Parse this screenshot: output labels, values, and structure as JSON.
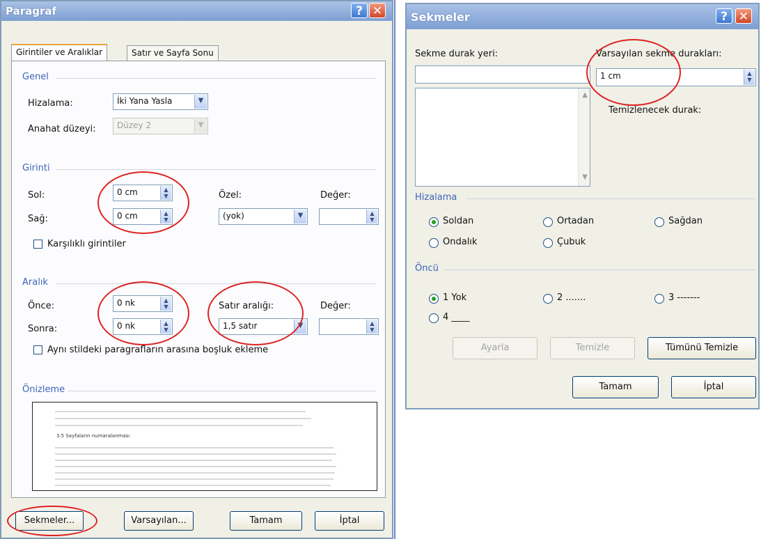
{
  "paragraph_dialog": {
    "title": "Paragraf",
    "help_glyph": "?",
    "close_glyph": "✕",
    "tabs": [
      "Girintiler ve Aralıklar",
      "Satır ve Sayfa Sonu"
    ],
    "general": {
      "section": "Genel",
      "alignment_label": "Hizalama:",
      "alignment_value": "İki Yana Yasla",
      "outline_label": "Anahat düzeyi:",
      "outline_value": "Düzey 2"
    },
    "indent": {
      "section": "Girinti",
      "left_label": "Sol:",
      "left_value": "0 cm",
      "right_label": "Sağ:",
      "right_value": "0 cm",
      "special_label": "Özel:",
      "special_value": "(yok)",
      "value_label": "Değer:",
      "mirror_label": "Karşılıklı girintiler"
    },
    "spacing": {
      "section": "Aralık",
      "before_label": "Önce:",
      "before_value": "0 nk",
      "after_label": "Sonra:",
      "after_value": "0 nk",
      "line_label": "Satır aralığı:",
      "line_value": "1,5 satır",
      "value_label": "Değer:",
      "no_space_label": "Aynı stildeki paragrafların arasına boşluk ekleme"
    },
    "preview": {
      "section": "Önizleme",
      "sample_heading": "3.5 Sayfaların numaralanması"
    },
    "buttons": {
      "tabs": "Sekmeler...",
      "defaults": "Varsayılan...",
      "ok": "Tamam",
      "cancel": "İptal"
    }
  },
  "tabs_dialog": {
    "title": "Sekmeler",
    "help_glyph": "?",
    "close_glyph": "✕",
    "tab_stop_label": "Sekme durak yeri:",
    "tab_stop_value": "",
    "default_stops_label": "Varsayılan sekme durakları:",
    "default_stops_value": "1 cm",
    "to_clear_label": "Temizlenecek durak:",
    "alignment": {
      "section": "Hizalama",
      "options": [
        "Soldan",
        "Ortadan",
        "Sağdan",
        "Ondalık",
        "Çubuk"
      ],
      "selected": "Soldan"
    },
    "leader": {
      "section": "Öncü",
      "options": [
        "1 Yok",
        "2 .......",
        "3 -------",
        "4 ____"
      ],
      "selected": "1 Yok"
    },
    "buttons": {
      "set": "Ayarla",
      "clear": "Temizle",
      "clear_all": "Tümünü Temizle",
      "ok": "Tamam",
      "cancel": "İptal"
    }
  },
  "colors": {
    "accent_label": "#3b64b8",
    "highlight_circle": "#d22222",
    "radio_selected": "#21a121"
  }
}
